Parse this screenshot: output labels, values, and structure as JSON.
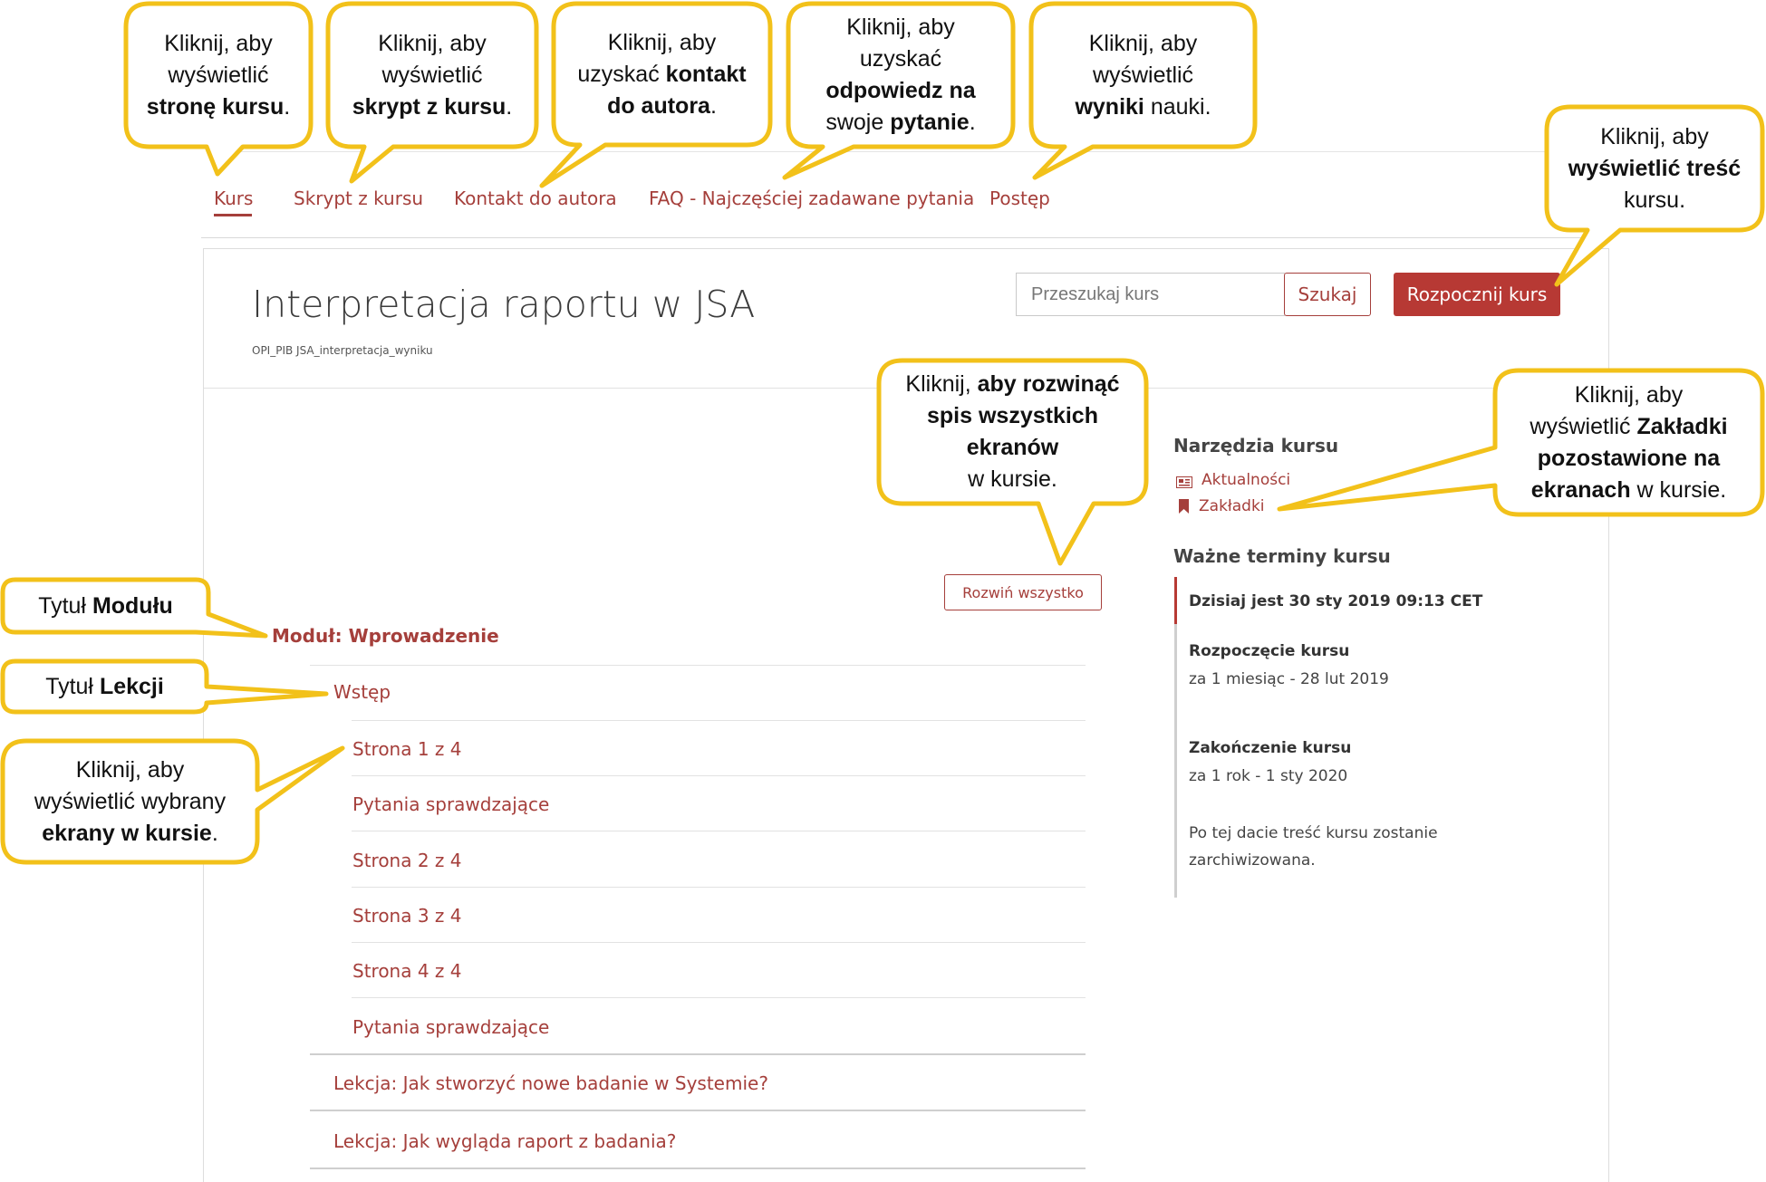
{
  "nav": {
    "tabs": [
      {
        "label": "Kurs",
        "active": true
      },
      {
        "label": "Skrypt z kursu"
      },
      {
        "label": "Kontakt do autora"
      },
      {
        "label": "FAQ - Najczęściej zadawane pytania"
      },
      {
        "label": "Postęp"
      }
    ]
  },
  "course": {
    "title": "Interpretacja raportu w JSA",
    "id": "OPI_PIB JSA_interpretacja_wyniku"
  },
  "search": {
    "placeholder": "Przeszukaj kurs",
    "button_label": "Szukaj"
  },
  "start_button": "Rozpocznij kurs",
  "expand_button": "Rozwiń wszystko",
  "outline": {
    "module_title": "Moduł: Wprowadzenie",
    "lesson_title": "Wstęp",
    "units": [
      "Strona 1 z 4",
      "Pytania sprawdzające",
      "Strona 2 z 4",
      "Strona 3 z 4",
      "Strona 4 z 4",
      "Pytania sprawdzające"
    ],
    "other_lessons": [
      "Lekcja: Jak stworzyć nowe badanie w Systemie?",
      "Lekcja: Jak wygląda raport z badania?"
    ]
  },
  "sidebar": {
    "tools_heading": "Narzędzia kursu",
    "tools": [
      {
        "label": "Aktualności",
        "icon": "newspaper-icon"
      },
      {
        "label": "Zakładki",
        "icon": "bookmark-icon"
      }
    ],
    "dates_heading": "Ważne terminy kursu",
    "today": "Dzisiaj jest 30 sty 2019 09:13 CET",
    "start_label": "Rozpoczęcie kursu",
    "start_value": "za 1 miesiąc - 28 lut 2019",
    "end_label": "Zakończenie kursu",
    "end_value": "za 1 rok - 1 sty 2020",
    "archive_note_line1": "Po tej dacie treść kursu zostanie",
    "archive_note_line2": "zarchiwizowana."
  },
  "callouts": {
    "kurs": [
      "Kliknij, aby",
      "wyświetlić",
      "stronę kursu",
      "."
    ],
    "skrypt": [
      "Kliknij, aby",
      "wyświetlić",
      "skrypt z  kursu",
      "."
    ],
    "kontakt": [
      "Kliknij, aby",
      "uzyskać ",
      "kontakt",
      "do autora",
      "."
    ],
    "faq": [
      "Kliknij, aby",
      "uzyskać",
      "odpowiedz na",
      "swoje ",
      "pytanie",
      "."
    ],
    "postep": [
      "Kliknij, aby",
      "wyświetlić",
      "wyniki",
      " nauki."
    ],
    "rozpocznij": [
      "Kliknij, aby",
      "wyświetlić treść",
      "kursu."
    ],
    "rozwin": [
      "Kliknij, ",
      "aby rozwinąć",
      "spis wszystkich",
      "ekranów",
      "w kursie."
    ],
    "zakladki": [
      "Kliknij, aby",
      "wyświetlić ",
      "Zakładki",
      "pozostawione na",
      "ekranach",
      " w kursie."
    ],
    "modul": [
      "Tytuł ",
      "Modułu"
    ],
    "lekcja": [
      "Tytuł ",
      "Lekcji"
    ],
    "ekrany": [
      "Kliknij, aby",
      "wyświetlić wybrany",
      "ekrany w kursie",
      "."
    ]
  },
  "colors": {
    "accent": "#a53f3b",
    "primary_button": "#b73934",
    "callout_border": "#f2c11a"
  }
}
